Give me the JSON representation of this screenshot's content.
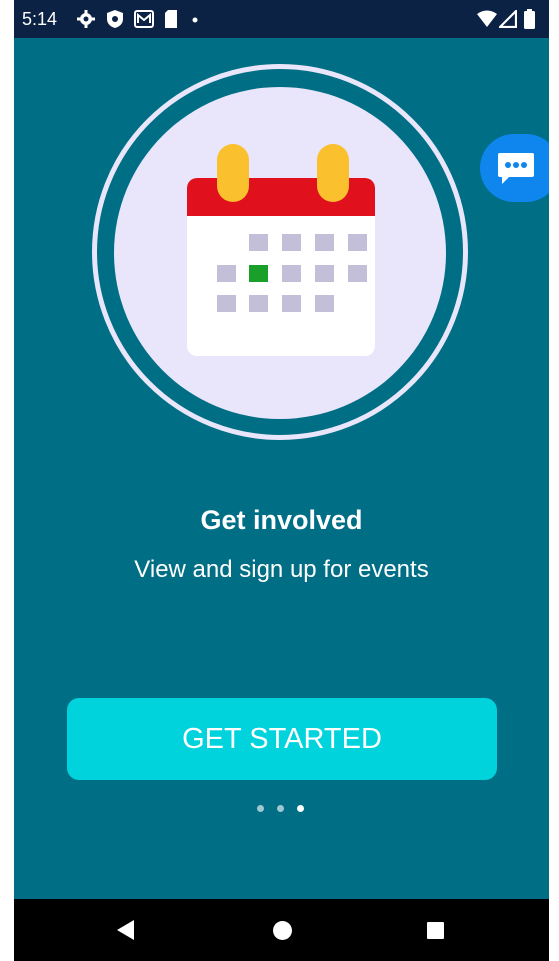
{
  "status_bar": {
    "time": "5:14",
    "left_icons": [
      "settings-icon",
      "shield-icon",
      "mail-icon",
      "sim-card-icon",
      "dot-icon"
    ],
    "right_icons": [
      "wifi-icon",
      "signal-icon",
      "battery-icon"
    ]
  },
  "illustration": {
    "icon": "calendar-icon",
    "highlight_color": "#1aa02a"
  },
  "chat_button": {
    "icon": "chat-bubble-icon"
  },
  "onboarding": {
    "title": "Get involved",
    "subtitle": "View and sign up for events",
    "cta_label": "GET STARTED",
    "page_count": 3,
    "current_page": 3
  },
  "nav_bar": {
    "icons": [
      "back-icon",
      "home-icon",
      "recents-icon"
    ]
  },
  "colors": {
    "background": "#006f85",
    "status_bar": "#0b2244",
    "circle": "#e9e6fb",
    "cta": "#00d3dc",
    "chat_button": "#0f86ee",
    "calendar_header": "#e0111c",
    "calendar_rings": "#fbc02d",
    "calendar_cells": "#c4bfd8"
  }
}
